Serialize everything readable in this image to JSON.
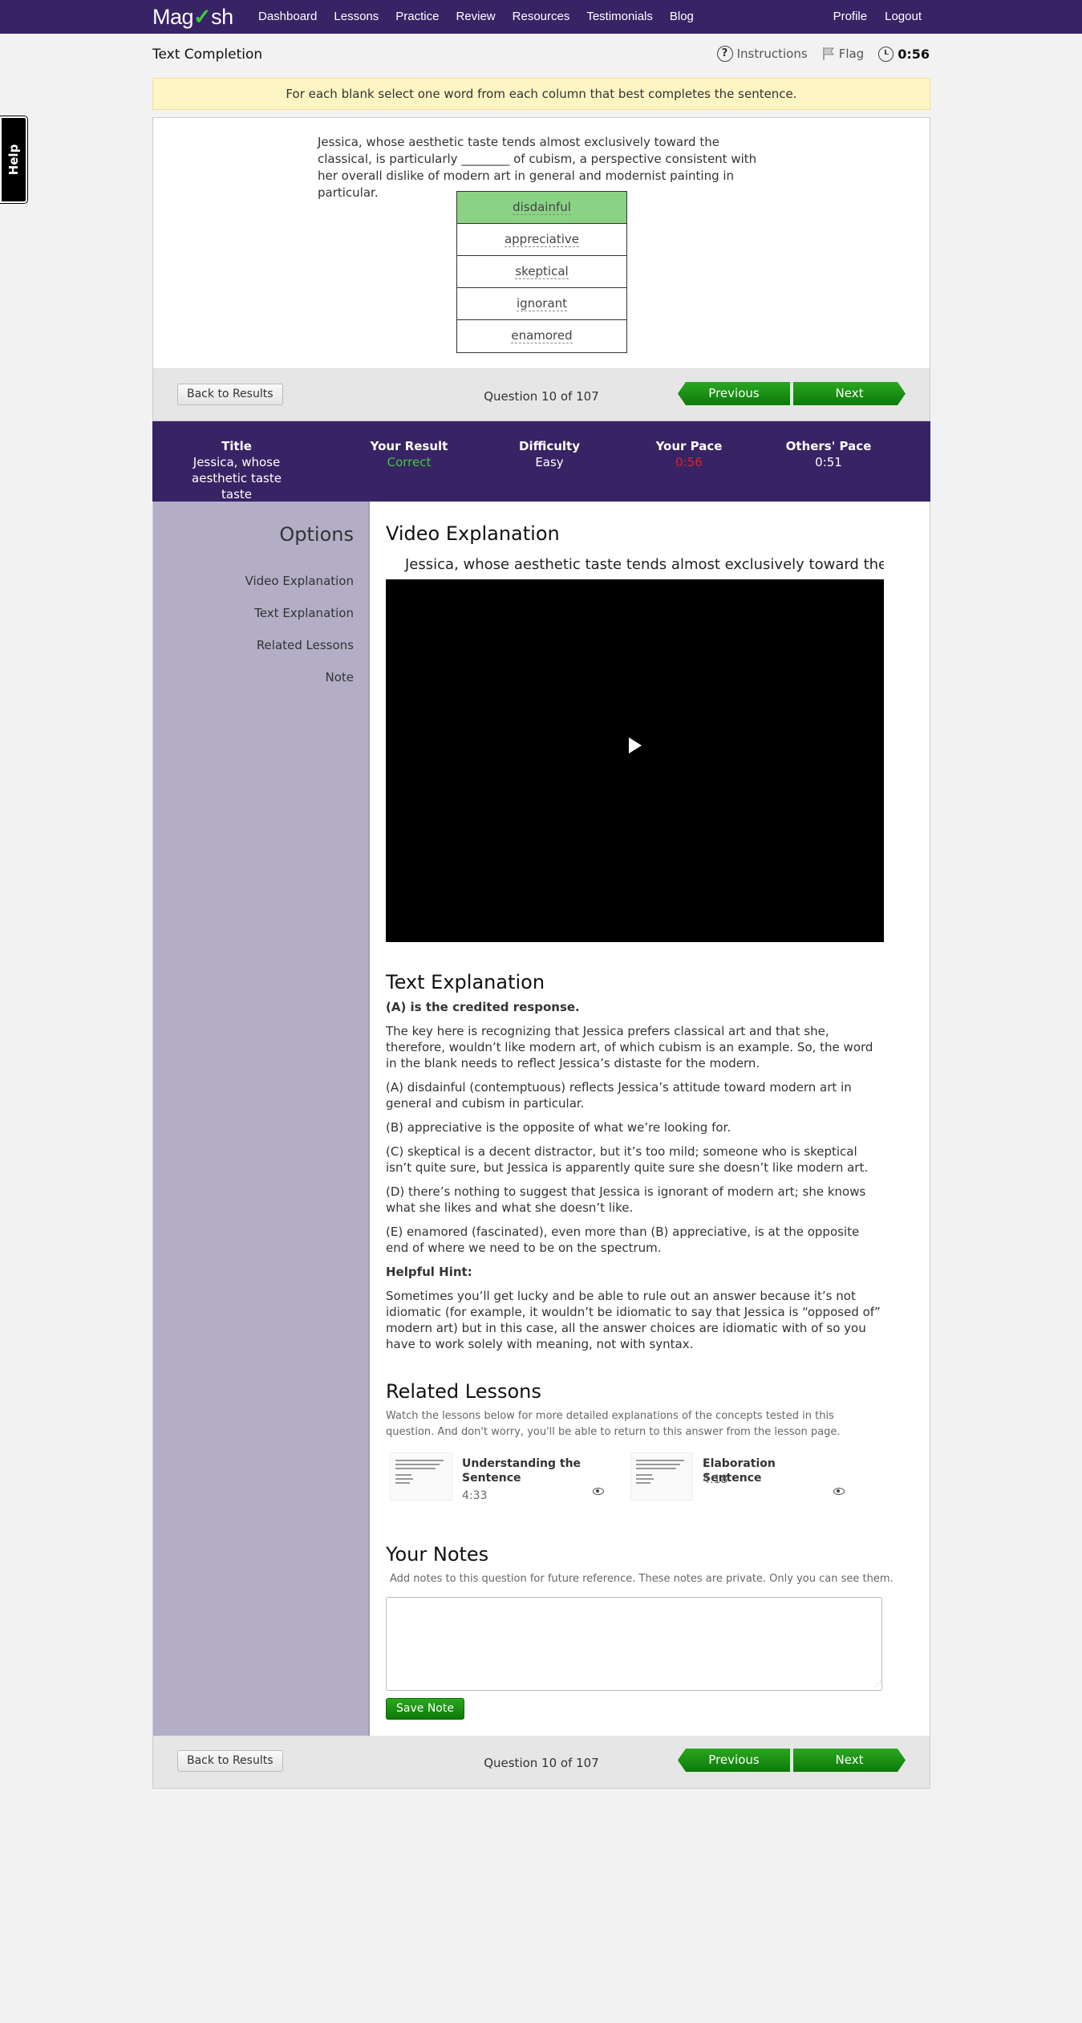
{
  "nav": {
    "logo_left": "Mag",
    "logo_check": "✓",
    "logo_right": "sh",
    "links": [
      "Dashboard",
      "Lessons",
      "Practice",
      "Review",
      "Resources",
      "Testimonials",
      "Blog"
    ],
    "right_links": [
      "Profile",
      "Logout"
    ]
  },
  "help_label": "Help",
  "header": {
    "question_type": "Text Completion",
    "instructions_label": "Instructions",
    "flag_label": "Flag",
    "timer": "0:56"
  },
  "banner": "For each blank select one word from each column that best completes the sentence.",
  "question": {
    "text": "Jessica, whose aesthetic taste tends almost exclusively toward the classical, is particularly ________ of cubism, a perspective consistent with her overall dislike of modern art in general and modernist painting in particular.",
    "choices": [
      "disdainful",
      "appreciative",
      "skeptical",
      "ignorant",
      "enamored"
    ],
    "selected_index": 0
  },
  "navbar": {
    "back_label": "Back to Results",
    "question_count": "Question 10 of 107",
    "previous_label": "Previous",
    "next_label": "Next"
  },
  "stats": {
    "title_label": "Title",
    "title_value": "Jessica, whose aesthetic taste",
    "result_label": "Your Result",
    "result_value": "Correct",
    "difficulty_label": "Difficulty",
    "difficulty_value": "Easy",
    "pace_label": "Your Pace",
    "pace_value": "0:56",
    "others_label": "Others' Pace",
    "others_value": "0:51",
    "colors": {
      "correct": "#3ecc3a",
      "slow": "#e02020"
    }
  },
  "options": {
    "title": "Options",
    "items": [
      "Video Explanation",
      "Text Explanation",
      "Related Lessons",
      "Note"
    ]
  },
  "video": {
    "heading": "Video Explanation",
    "caption": "Jessica, whose aesthetic taste tends almost exclusively toward the"
  },
  "text_explanation": {
    "heading": "Text Explanation",
    "credited": "(A) is the credited response.",
    "paragraphs": [
      "The key here is recognizing that Jessica prefers classical art and that she, therefore, wouldn’t like modern art, of which cubism is an example. So, the word in the blank needs to reflect Jessica’s distaste for the modern.",
      "(A) disdainful (contemptuous) reflects Jessica’s attitude toward modern art in general and cubism in particular.",
      "(B) appreciative is the opposite of what we’re looking for.",
      "(C) skeptical is a decent distractor, but it’s too mild; someone who is skeptical isn’t quite sure, but Jessica is apparently quite sure she doesn’t like modern art.",
      "(D) there’s nothing to suggest that Jessica is ignorant of modern art; she knows what she likes and what she doesn’t like.",
      "(E) enamored (fascinated), even more than (B) appreciative, is at the opposite end of where we need to be on the spectrum."
    ],
    "hint_label": "Helpful Hint:",
    "hint": "Sometimes you’ll get lucky and be able to rule out an answer because it’s not idiomatic (for example, it wouldn’t be idiomatic to say that Jessica is “opposed of” modern art) but in this case, all the answer choices are idiomatic with of so you have to work solely with meaning, not with syntax."
  },
  "related": {
    "heading": "Related Lessons",
    "description": "Watch the lessons below for more detailed explanations of the concepts tested in this question. And don't worry, you'll be able to return to this answer from the lesson page.",
    "lessons": [
      {
        "title": "Understanding the Sentence",
        "duration": "4:33",
        "icon": "eye-icon"
      },
      {
        "title": "Elaboration Sentence",
        "duration": "4:18",
        "icon": "eye-icon"
      }
    ]
  },
  "notes": {
    "heading": "Your Notes",
    "description": "Add notes to this question for future reference. These notes are private. Only you can see them.",
    "value": "",
    "save_label": "Save Note"
  }
}
